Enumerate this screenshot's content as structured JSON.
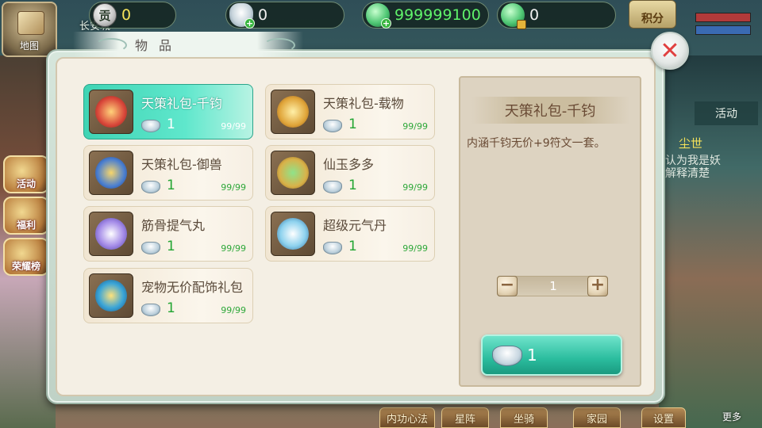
{
  "hud": {
    "map_label": "地图",
    "city_label": "长安城",
    "currencies": [
      {
        "name": "contribution",
        "icon": "contribution-coin-icon",
        "value": "0",
        "glyph": "贡"
      },
      {
        "name": "silver",
        "icon": "silver-ingot-icon",
        "value": "0"
      },
      {
        "name": "jade",
        "icon": "jade-icon",
        "value": "999999100"
      },
      {
        "name": "bound-jade",
        "icon": "locked-jade-icon",
        "value": "0"
      }
    ],
    "points_label": "积分",
    "side_buttons": [
      "活动",
      "福利",
      "荣耀榜"
    ]
  },
  "right_panel": {
    "activity_tab": "活动",
    "event_title": "尘世",
    "event_lines": [
      "认为我是妖",
      "解释清楚"
    ]
  },
  "bottom_bar": [
    "内功心法",
    "星阵",
    "坐骑",
    "家园",
    "设置"
  ],
  "more_label": "更多",
  "panel": {
    "tab_label": "物品",
    "items": [
      {
        "name": "天策礼包-千钧",
        "price": "1",
        "stock": "99/99",
        "selected": true,
        "icon": "gift-pack-red-icon",
        "color": "#d9473a"
      },
      {
        "name": "天策礼包-载物",
        "price": "1",
        "stock": "99/99",
        "selected": false,
        "icon": "gift-pack-gold-icon",
        "color": "#e0a53a"
      },
      {
        "name": "天策礼包-御兽",
        "price": "1",
        "stock": "99/99",
        "selected": false,
        "icon": "gift-pack-blue-icon",
        "color": "#4b7fd0"
      },
      {
        "name": "仙玉多多",
        "price": "1",
        "stock": "99/99",
        "selected": false,
        "icon": "jade-bag-icon",
        "color": "#d8b24a"
      },
      {
        "name": "筋骨提气丸",
        "price": "1",
        "stock": "99/99",
        "selected": false,
        "icon": "purple-pill-icon",
        "color": "#a58ce8"
      },
      {
        "name": "超级元气丹",
        "price": "1",
        "stock": "99/99",
        "selected": false,
        "icon": "blue-orb-icon",
        "color": "#8ed2ee"
      },
      {
        "name": "宠物无价配饰礼包",
        "price": "1",
        "stock": "99/99",
        "selected": false,
        "icon": "pet-gift-icon",
        "color": "#3aa5d8"
      }
    ],
    "detail": {
      "title": "天策礼包-千钧",
      "description": "内涵千钧无价+9符文一套。",
      "quantity": "1",
      "minus": "−",
      "plus": "+",
      "buy_price": "1"
    },
    "close_glyph": "✕"
  }
}
